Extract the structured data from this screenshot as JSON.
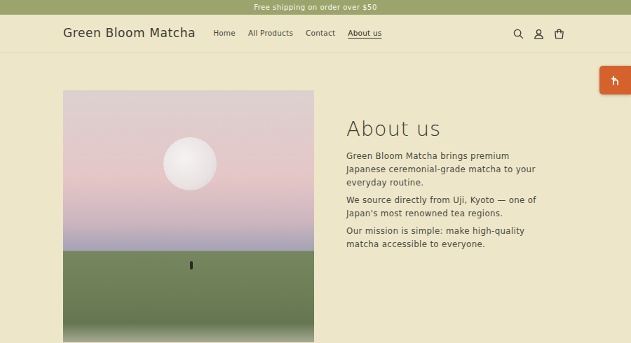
{
  "announcement": "Free shipping on order over $50",
  "header": {
    "logo": "Green Bloom Matcha",
    "nav": [
      {
        "label": "Home",
        "selected": false
      },
      {
        "label": "All Products",
        "selected": false
      },
      {
        "label": "Contact",
        "selected": false
      },
      {
        "label": "About us",
        "selected": true
      }
    ]
  },
  "page": {
    "title": "About us",
    "paragraphs": [
      "Green Bloom Matcha brings premium Japanese ceremonial-grade matcha to your everyday routine.",
      "We source directly from Uji, Kyoto — one of Japan's most renowned tea regions.",
      "Our mission is simple: make high-quality matcha accessible to everyone."
    ]
  }
}
